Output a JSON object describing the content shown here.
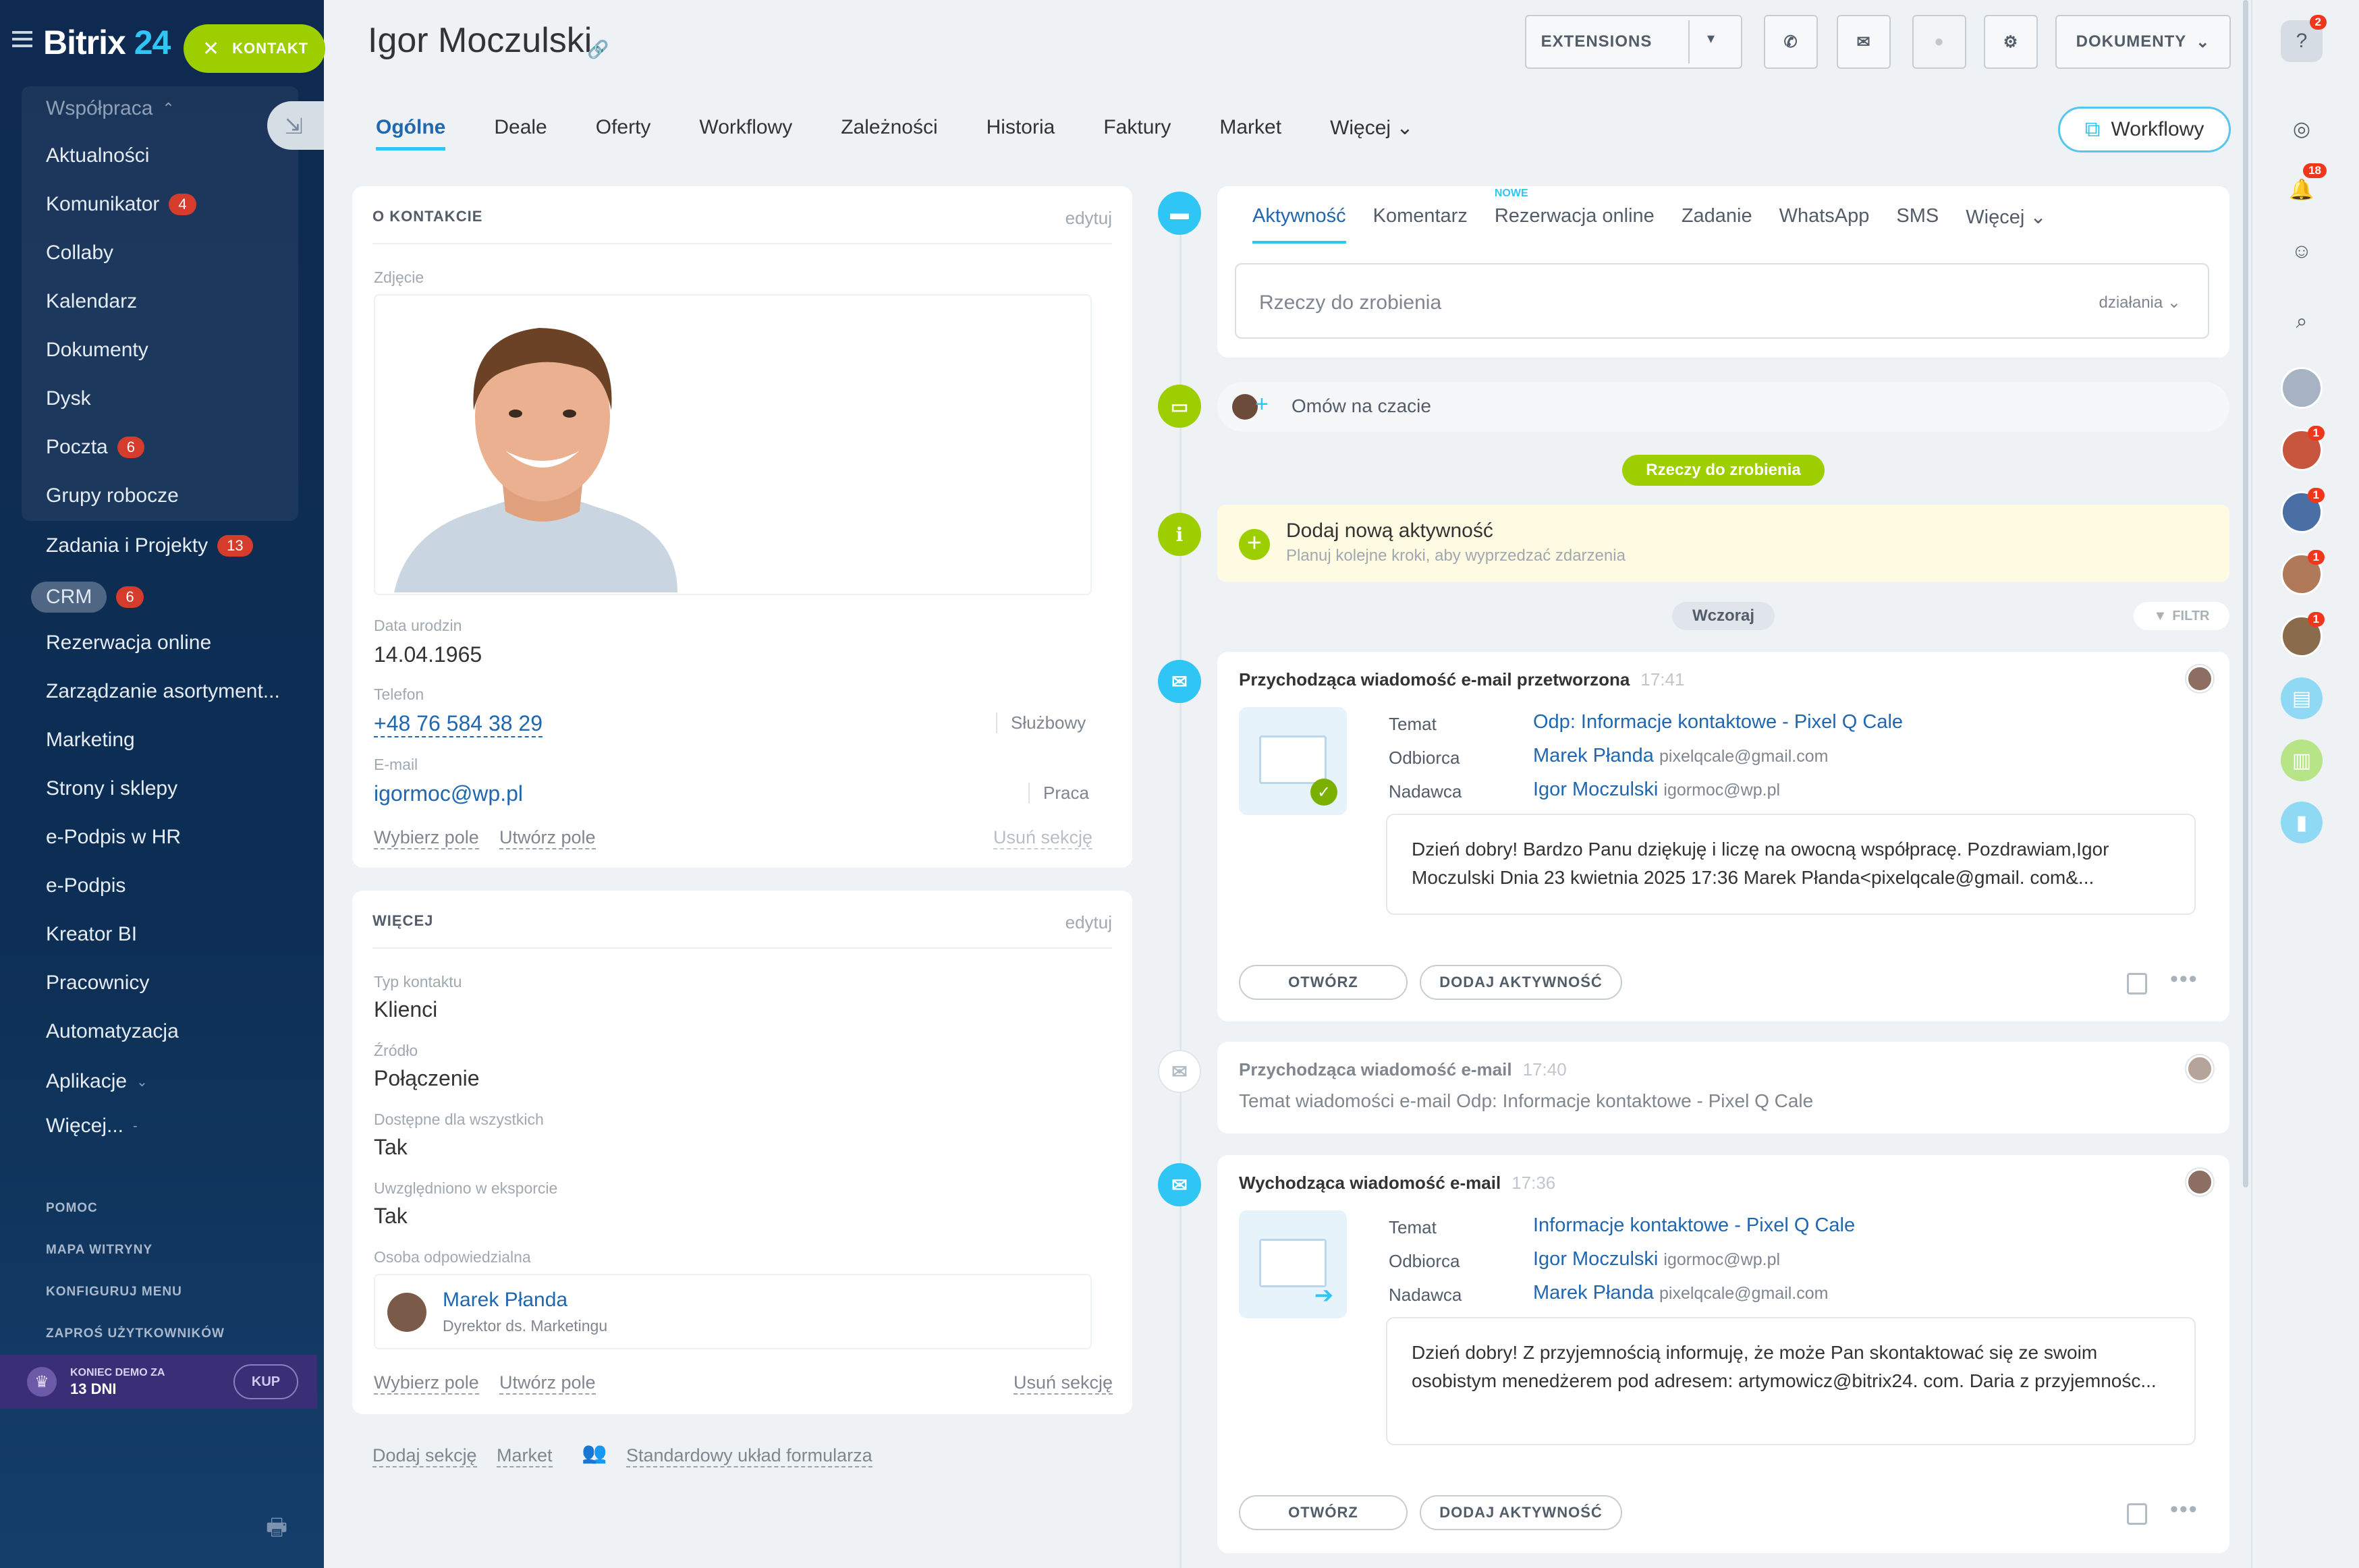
{
  "sidebar": {
    "logo_main": "Bitrix",
    "logo_num": "24",
    "kontakt_button": "KONTAKT",
    "group_label": "Współpraca",
    "group_items": [
      {
        "label": "Aktualności"
      },
      {
        "label": "Komunikator",
        "count": "4"
      },
      {
        "label": "Collaby"
      },
      {
        "label": "Kalendarz"
      },
      {
        "label": "Dokumenty"
      },
      {
        "label": "Dysk"
      },
      {
        "label": "Poczta",
        "count": "6"
      },
      {
        "label": "Grupy robocze"
      }
    ],
    "items": [
      {
        "label": "Zadania i Projekty",
        "count": "13"
      },
      {
        "label": "CRM",
        "count": "6"
      },
      {
        "label": "Rezerwacja online"
      },
      {
        "label": "Zarządzanie asortyment..."
      },
      {
        "label": "Marketing"
      },
      {
        "label": "Strony i sklepy"
      },
      {
        "label": "e-Podpis w HR"
      },
      {
        "label": "e-Podpis"
      },
      {
        "label": "Kreator BI"
      },
      {
        "label": "Pracownicy"
      },
      {
        "label": "Automatyzacja"
      },
      {
        "label": "Aplikacje"
      },
      {
        "label": "Więcej..."
      }
    ],
    "small_links": [
      "POMOC",
      "MAPA WITRYNY",
      "KONFIGURUJ MENU",
      "ZAPROŚ UŻYTKOWNIKÓW"
    ],
    "demo_label": "KONIEC DEMO ZA",
    "demo_days": "13 DNI",
    "buy_button": "KUP"
  },
  "header": {
    "title": "Igor Moczulski",
    "extensions_button": "EXTENSIONS",
    "documents_button": "DOKUMENTY",
    "workflow_button": "Workflowy"
  },
  "tabs": [
    "Ogólne",
    "Deale",
    "Oferty",
    "Workflowy",
    "Zależności",
    "Historia",
    "Faktury",
    "Market",
    "Więcej"
  ],
  "about": {
    "title": "O KONTAKCIE",
    "edit": "edytuj",
    "photo_label": "Zdjęcie",
    "birth_label": "Data urodzin",
    "birth_value": "14.04.1965",
    "phone_label": "Telefon",
    "phone_value": "+48 76 584 38 29",
    "phone_type": "Służbowy",
    "email_label": "E-mail",
    "email_value": "igormoc@wp.pl",
    "email_type": "Praca",
    "choose_field": "Wybierz pole",
    "create_field": "Utwórz pole",
    "delete_section": "Usuń sekcję"
  },
  "more": {
    "title": "WIĘCEJ",
    "edit": "edytuj",
    "type_label": "Typ kontaktu",
    "type_value": "Klienci",
    "source_label": "Źródło",
    "source_value": "Połączenie",
    "available_label": "Dostępne dla wszystkich",
    "available_value": "Tak",
    "export_label": "Uwzględniono w eksporcie",
    "export_value": "Tak",
    "responsible_label": "Osoba odpowiedzialna",
    "responsible_name": "Marek Płanda",
    "responsible_role": "Dyrektor ds. Marketingu",
    "choose_field": "Wybierz pole",
    "create_field": "Utwórz pole",
    "delete_section": "Usuń sekcję"
  },
  "bottom_links": {
    "add_section": "Dodaj sekcję",
    "market": "Market",
    "standard_layout": "Standardowy układ formularza"
  },
  "feed": {
    "tabs": [
      "Aktywność",
      "Komentarz",
      "Rezerwacja online",
      "Zadanie",
      "WhatsApp",
      "SMS",
      "Więcej"
    ],
    "new_tag": "NOWE",
    "todo_placeholder": "Rzeczy do zrobienia",
    "actions_label": "działania",
    "discuss": "Omów na czacie",
    "todo_pill": "Rzeczy do zrobienia",
    "add_activity_title": "Dodaj nową aktywność",
    "add_activity_sub": "Planuj kolejne kroki, aby wyprzedzać zdarzenia",
    "yesterday": "Wczoraj",
    "filter": "FILTR"
  },
  "mail1": {
    "title": "Przychodząca wiadomość e-mail przetworzona",
    "time": "17:41",
    "subject_label": "Temat",
    "subject": "Odp: Informacje kontaktowe - Pixel Q Cale",
    "to_label": "Odbiorca",
    "to_name": "Marek Płanda",
    "to_email": "pixelqcale@gmail.com",
    "from_label": "Nadawca",
    "from_name": "Igor Moczulski",
    "from_email": "igormoc@wp.pl",
    "body": "Dzień dobry! Bardzo Panu dziękuję i liczę na owocną współpracę. Pozdrawiam,Igor Moczulski Dnia 23 kwietnia 2025 17:36 Marek Płanda<pixelqcale@gmail. com&...",
    "open_button": "OTWÓRZ",
    "add_button": "DODAJ AKTYWNOŚĆ"
  },
  "mail2": {
    "title": "Przychodząca wiadomość e-mail",
    "time": "17:40",
    "subject_label": "Temat wiadomości e-mail",
    "subject": "Odp: Informacje kontaktowe - Pixel Q Cale"
  },
  "mail3": {
    "title": "Wychodząca wiadomość e-mail",
    "time": "17:36",
    "subject_label": "Temat",
    "subject": "Informacje kontaktowe - Pixel Q Cale",
    "to_label": "Odbiorca",
    "to_name": "Igor Moczulski",
    "to_email": "igormoc@wp.pl",
    "from_label": "Nadawca",
    "from_name": "Marek Płanda",
    "from_email": "pixelqcale@gmail.com",
    "body": "Dzień dobry! Z przyjemnością informuję,  że może Pan skontaktować się ze swoim osobistym menedżerem pod adresem: artymowicz@bitrix24. com. Daria z przyjemnośc...",
    "open_button": "OTWÓRZ",
    "add_button": "DODAJ AKTYWNOŚĆ"
  },
  "rightbar": {
    "help_badge": "2",
    "notif_badge": "18",
    "avatar_badges": [
      "1",
      "1",
      "1",
      "1"
    ]
  },
  "colors": {
    "accent_green": "#9dcf00",
    "accent_blue": "#2fc6f6",
    "link_blue": "#2067b0",
    "badge_red": "#d63c2c"
  }
}
